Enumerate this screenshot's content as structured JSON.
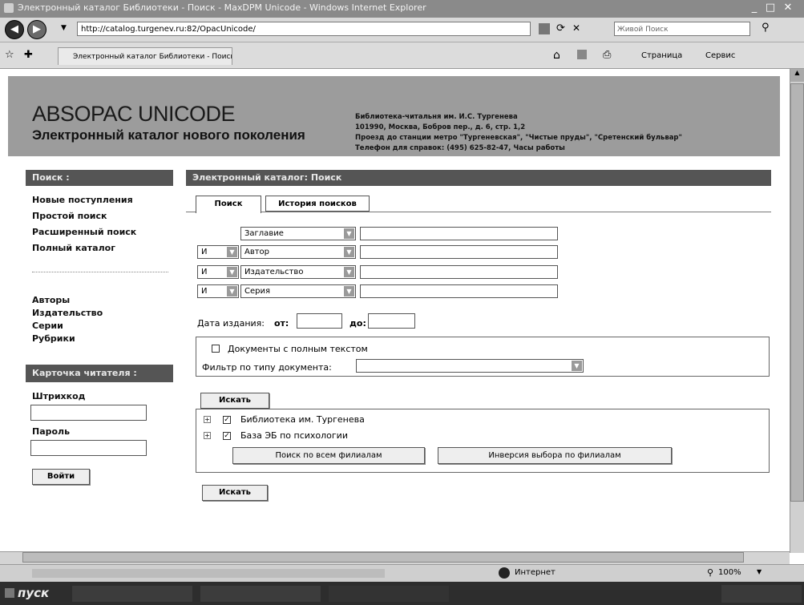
{
  "window": {
    "title": "Электронный каталог Библиотеки - Поиск - MaxDPM Unicode - Windows Internet Explorer"
  },
  "browser": {
    "url": "http://catalog.turgenev.ru:82/OpacUnicode/",
    "search_placeholder": "Живой Поиск",
    "tab_title": "Электронный каталог Библиотеки - Поиск - Absop...",
    "page_menu": "Страница",
    "tools_menu": "Сервис"
  },
  "header": {
    "logo": "ABSOPAC UNICODE",
    "subtitle": "Электронный каталог нового поколения",
    "library_lines": [
      "Библиотека-читальня им. И.С. Тургенева",
      "101990, Москва, Бобров пер., д. 6, стр. 1,2",
      "Проезд до станции метро \"Тургеневская\", \"Чистые пруды\", \"Сретенский бульвар\"",
      "Телефон для справок: (495) 625-82-47, Часы работы"
    ]
  },
  "sidebar": {
    "search_header": "Поиск :",
    "links_top": [
      "Новые поступления",
      "Простой поиск",
      "Расширенный поиск",
      "Полный каталог"
    ],
    "links_bottom": [
      "Авторы",
      "Издательство",
      "Серии",
      "Рубрики"
    ],
    "card_header": "Карточка читателя :",
    "barcode_label": "Штрихкод",
    "password_label": "Пароль",
    "login_button": "Войти"
  },
  "main": {
    "panel_header": "Электронный каталог: Поиск",
    "tab_search": "Поиск",
    "tab_history": "История поисков",
    "rows": [
      {
        "op": "",
        "field": "Заглавие"
      },
      {
        "op": "И",
        "field": "Автор"
      },
      {
        "op": "И",
        "field": "Издательство"
      },
      {
        "op": "И",
        "field": "Серия"
      }
    ],
    "date_label": "Дата издания:",
    "date_from": "от:",
    "date_to": "до:",
    "fulltext_label": "Документы с полным текстом",
    "doctype_label": "Фильтр по типу документа:",
    "search_button": "Искать",
    "bases": [
      "Библиотека им. Тургенева",
      "База ЭБ по психологии"
    ],
    "search_all_button": "Поиск по всем филиалам",
    "invert_button": "Инверсия выбора по филиалам"
  },
  "statusbar": {
    "zone": "Интернет",
    "zoom": "100%"
  },
  "taskbar": {
    "start": "пуск"
  }
}
